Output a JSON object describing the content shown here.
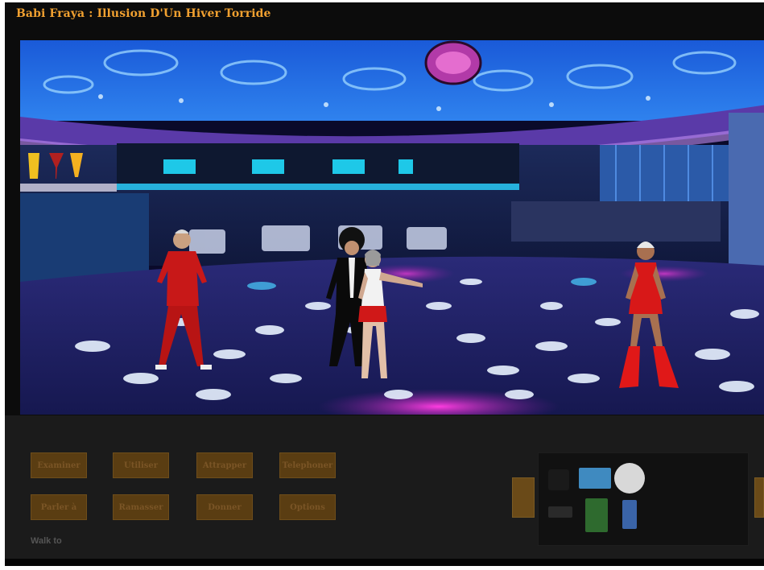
{
  "game": {
    "title": "Babi Fraya : Illusion D'Un Hiver Torride"
  },
  "verbs": [
    {
      "label": "Examiner"
    },
    {
      "label": "Utiliser"
    },
    {
      "label": "Attrapper"
    },
    {
      "label": "Telephoner"
    },
    {
      "label": "Parler à"
    },
    {
      "label": "Ramasser"
    },
    {
      "label": "Donner"
    },
    {
      "label": "Options"
    }
  ],
  "status_line": "Walk to",
  "inventory": {
    "items": [
      "phone-icon",
      "cassette-icon",
      "orb-icon",
      "pad-icon",
      "green-card-icon",
      "blue-card-icon"
    ]
  },
  "colors": {
    "title": "#f0a030",
    "verb_bg": "#5a3d12",
    "verb_text": "#7a5526",
    "panel_bg": "#1b1b1b"
  }
}
